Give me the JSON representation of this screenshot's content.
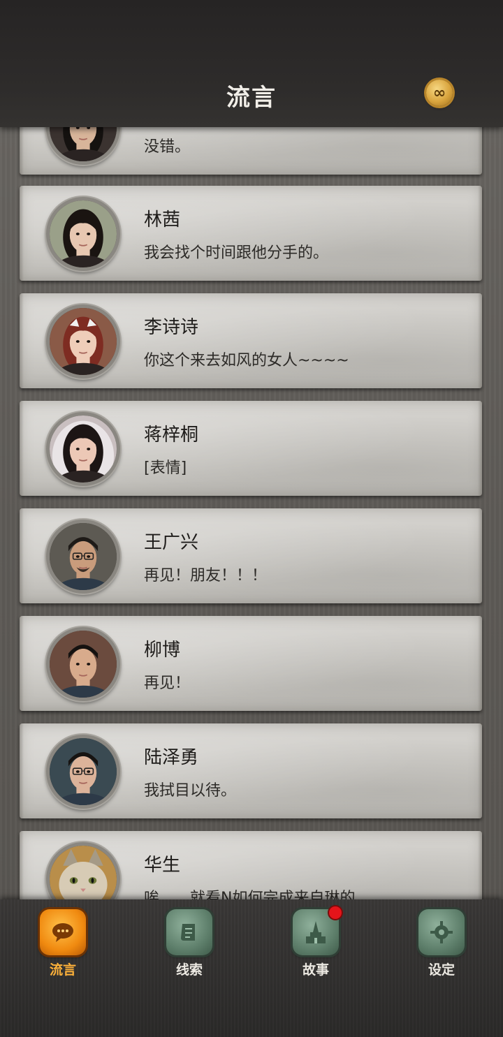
{
  "header": {
    "title": "流言",
    "badge_symbol": "∞"
  },
  "messages": [
    {
      "name": "",
      "preview": "没错。",
      "avatar": "woman-dark-hair",
      "skin": "#d8b59a",
      "hair": "#151210",
      "bg": "#3b3330",
      "has_bell": true
    },
    {
      "name": "林茜",
      "preview": "我会找个时间跟他分手的。",
      "avatar": "woman-long-black-hair",
      "skin": "#e7c7b1",
      "hair": "#1a1411",
      "bg": "#9aa089",
      "has_bell": false
    },
    {
      "name": "李诗诗",
      "preview": "你这个来去如风的女人~~~~",
      "avatar": "woman-red-hair-maid",
      "skin": "#efcdb9",
      "hair": "#7e2c22",
      "bg": "#8a5a47",
      "has_bell": false
    },
    {
      "name": "蒋梓桐",
      "preview": "[表情]",
      "avatar": "woman-white-hood",
      "skin": "#ecc8b6",
      "hair": "#1c1514",
      "bg": "#c9bfc0",
      "has_bell": false
    },
    {
      "name": "王广兴",
      "preview": "再见！朋友！！！",
      "avatar": "man-glasses-beard",
      "skin": "#c99c7c",
      "hair": "#1e1a17",
      "bg": "#5d5a53",
      "has_bell": false
    },
    {
      "name": "柳博",
      "preview": "再见！",
      "avatar": "man-slick-hair",
      "skin": "#d8ab8c",
      "hair": "#151210",
      "bg": "#6b4b3e",
      "has_bell": false
    },
    {
      "name": "陆泽勇",
      "preview": "我拭目以待。",
      "avatar": "man-glasses-young",
      "skin": "#dcb39a",
      "hair": "#171412",
      "bg": "#3a4a52",
      "has_bell": false
    },
    {
      "name": "华生",
      "preview": "唉……就看N如何完成来自琳的…",
      "avatar": "cat",
      "skin": "#d7cbb5",
      "hair": "#a59a86",
      "bg": "#b98e4a",
      "has_bell": false
    }
  ],
  "nav": {
    "items": [
      {
        "label": "流言",
        "icon": "chat-bubble-icon",
        "active": true,
        "notify": false
      },
      {
        "label": "线索",
        "icon": "scroll-icon",
        "active": false,
        "notify": false
      },
      {
        "label": "故事",
        "icon": "tower-icon",
        "active": false,
        "notify": true
      },
      {
        "label": "设定",
        "icon": "gear-icon",
        "active": false,
        "notify": false
      }
    ]
  },
  "colors": {
    "active_accent": "#f08a10",
    "notify_red": "#e4141a",
    "nav_green": "#5e7f6b"
  }
}
